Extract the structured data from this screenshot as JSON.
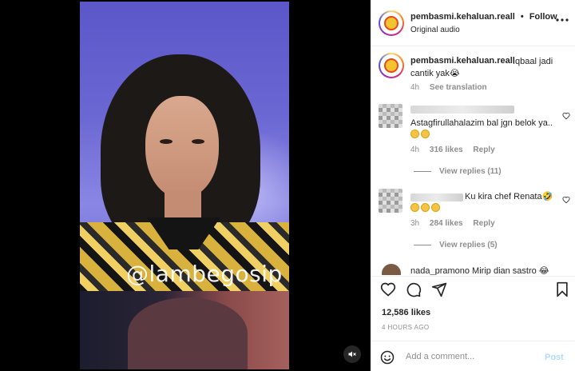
{
  "video": {
    "watermark": "@lambegosip",
    "mute_icon": "speaker-muted-icon"
  },
  "header": {
    "username": "pembasmi.kehaluan.reall",
    "separator": "•",
    "follow_label": "Follow",
    "subtitle": "Original audio",
    "more_icon": "ellipsis-icon"
  },
  "caption": {
    "username": "pembasmi.kehaluan.reall",
    "text": "Iqbaal jadi cantik yak😭",
    "time": "4h",
    "see_translation": "See translation"
  },
  "comments": [
    {
      "text": "Astagfirullahalazim bal jgn belok ya..",
      "emoji_line": "😟😂",
      "time": "4h",
      "likes": "316 likes",
      "reply_label": "Reply",
      "view_replies": "View replies (11)"
    },
    {
      "text": "Ku kira chef Renata🤣",
      "emoji_line": "🤣🤣🤣",
      "time": "3h",
      "likes": "284 likes",
      "reply_label": "Reply",
      "view_replies": "View replies (5)"
    },
    {
      "text": "nada_pramono Mirip dian sastro 😂"
    }
  ],
  "actions": {
    "like_icon": "heart-icon",
    "comment_icon": "comment-bubble-icon",
    "share_icon": "send-paper-plane-icon",
    "save_icon": "bookmark-icon"
  },
  "likes": "12,586 likes",
  "posted_ago": "4 HOURS AGO",
  "add_comment": {
    "placeholder": "Add a comment...",
    "post_label": "Post",
    "emoji_icon": "smiley-face-icon"
  },
  "colors": {
    "post_disabled": "#b3dbff",
    "secondary_text": "#8e8e8e",
    "primary_text": "#262626"
  }
}
